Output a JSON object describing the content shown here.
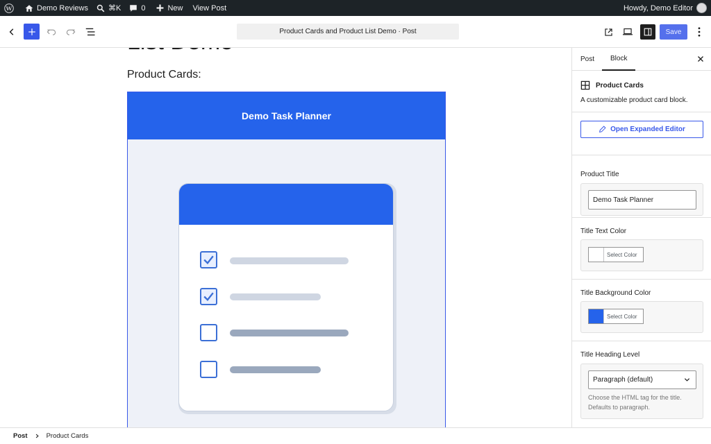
{
  "admin_bar": {
    "site_name": "Demo Reviews",
    "search_shortcut": "⌘K",
    "comments_count": "0",
    "new_label": "New",
    "view_post_label": "View Post",
    "greeting": "Howdy, Demo Editor"
  },
  "toolbar": {
    "document_title": "Product Cards and Product List Demo · Post",
    "save_label": "Save"
  },
  "content": {
    "post_title_fragment": "List Demo",
    "heading": "Product Cards:",
    "card_title": "Demo Task Planner",
    "card_title_bg": "#2563eb",
    "checklist": [
      {
        "checked": true
      },
      {
        "checked": true
      },
      {
        "checked": false
      },
      {
        "checked": false
      }
    ]
  },
  "sidebar": {
    "tabs": [
      {
        "label": "Post",
        "active": false
      },
      {
        "label": "Block",
        "active": true
      }
    ],
    "block_name": "Product Cards",
    "block_description": "A customizable product card block.",
    "open_editor_label": "Open Expanded Editor",
    "product_title_label": "Product Title",
    "product_title_value": "Demo Task Planner",
    "title_text_color_label": "Title Text Color",
    "title_text_color_value": "#ffffff",
    "title_bg_color_label": "Title Background Color",
    "title_bg_color_value": "#2563eb",
    "select_color_label": "Select Color",
    "heading_level_label": "Title Heading Level",
    "heading_level_value": "Paragraph (default)",
    "heading_level_help": "Choose the HTML tag for the title. Defaults to paragraph."
  },
  "breadcrumb": {
    "root": "Post",
    "current": "Product Cards"
  }
}
